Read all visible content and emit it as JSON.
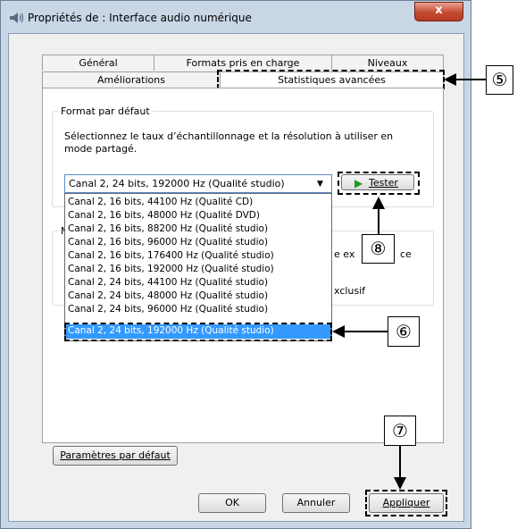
{
  "window": {
    "title": "Propriétés de : Interface audio numérique",
    "close_label": "x"
  },
  "tabs": {
    "row1": [
      "Général",
      "Formats pris en charge",
      "Niveaux"
    ],
    "row2": [
      "Améliorations",
      "Statistiques avancées"
    ],
    "active": "Statistiques avancées"
  },
  "default_format": {
    "group_label": "Format par défaut",
    "description": "Sélectionnez le taux d’échantillonnage et la résolution à utiliser en mode partagé.",
    "selected_value": "Canal 2, 24 bits, 192000 Hz (Qualité studio)",
    "test_button_label": "Tester",
    "options": [
      "Canal 2, 16 bits, 44100 Hz (Qualité CD)",
      "Canal 2, 16 bits, 48000 Hz (Qualité DVD)",
      "Canal 2, 16 bits, 88200 Hz (Qualité studio)",
      "Canal 2, 16 bits, 96000 Hz (Qualité studio)",
      "Canal 2, 16 bits, 176400 Hz (Qualité studio)",
      "Canal 2, 16 bits, 192000 Hz (Qualité studio)",
      "Canal 2, 24 bits, 44100 Hz (Qualité studio)",
      "Canal 2, 24 bits, 48000 Hz (Qualité studio)",
      "Canal 2, 24 bits, 96000 Hz (Qualité studio)",
      "Canal 2, 24 bits, 192000 Hz (Qualité studio)"
    ],
    "highlighted_index": 9
  },
  "exclusive_mode": {
    "group_label_fragment": "M",
    "text_fragment_1": "e ex",
    "text_fragment_2": "ce",
    "text_fragment_3": "xclusif"
  },
  "buttons": {
    "defaults": "Paramètres par défaut",
    "ok": "OK",
    "cancel": "Annuler",
    "apply": "Appliquer"
  },
  "callouts": {
    "c5": "⑤",
    "c6": "⑥",
    "c7": "⑦",
    "c8": "⑧"
  },
  "colors": {
    "selection": "#3399ff",
    "frame": "#c9d6e6",
    "close_button": "#c44a32",
    "play_icon": "#1f9a1f"
  }
}
